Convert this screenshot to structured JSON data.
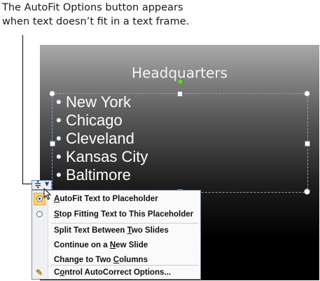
{
  "caption": {
    "line1": "The AutoFit Options button appears",
    "line2": "when text doesn’t fit in a text frame."
  },
  "slide": {
    "title": "Headquarters",
    "bullets": [
      "New York",
      "Chicago",
      "Cleveland",
      "Kansas City",
      "Baltimore"
    ]
  },
  "autofit_button": {
    "icon": "autofit-icon",
    "dropdown_icon": "chevron-down-icon"
  },
  "menu": {
    "items": [
      {
        "pre": "",
        "u": "A",
        "post": "utoFit Text to Placeholder",
        "icon": "radio-selected"
      },
      {
        "pre": "",
        "u": "S",
        "post": "top Fitting Text to This Placeholder",
        "icon": "radio"
      },
      {
        "pre": "Split Text Between ",
        "u": "T",
        "post": "wo Slides",
        "icon": ""
      },
      {
        "pre": "Continue on a ",
        "u": "N",
        "post": "ew Slide",
        "icon": ""
      },
      {
        "pre": "Change to Two ",
        "u": "C",
        "post": "olumns",
        "icon": ""
      },
      {
        "pre": "C",
        "u": "o",
        "post": "ntrol AutoCorrect Options...",
        "icon": "autocorrect-icon"
      }
    ]
  }
}
